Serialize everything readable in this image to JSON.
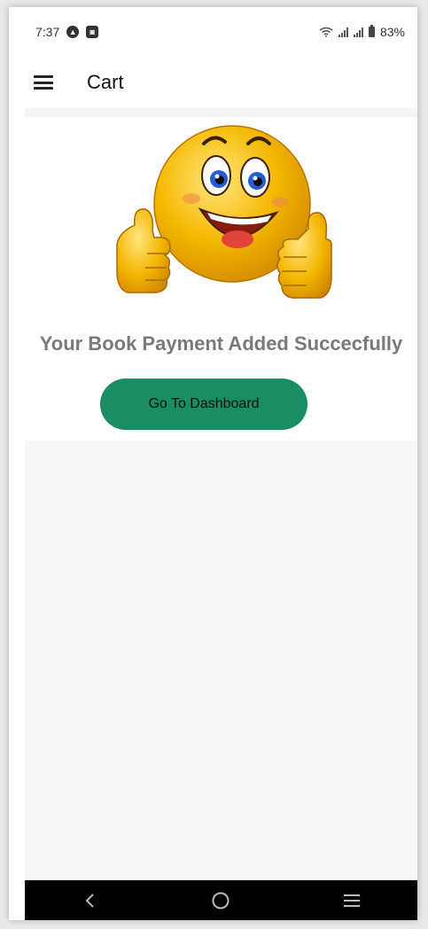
{
  "status_bar": {
    "time": "7:37",
    "notification_icons": [
      "android-auto-icon",
      "app-notification-icon"
    ],
    "battery_percent": "83%"
  },
  "app_bar": {
    "title": "Cart",
    "menu_icon": "hamburger-menu-icon"
  },
  "main": {
    "emoji_icon": "thumbs-up-smiley-icon",
    "message": "Your Book Payment Added Succecfully",
    "dashboard_button_label": "Go To Dashboard"
  },
  "nav_bar": {
    "icons": [
      "back-icon",
      "home-icon",
      "recent-apps-icon"
    ]
  },
  "colors": {
    "button_green": "#1a8e63",
    "message_grey": "#7a7a7a",
    "emoji_yellow": "#f5b800"
  }
}
